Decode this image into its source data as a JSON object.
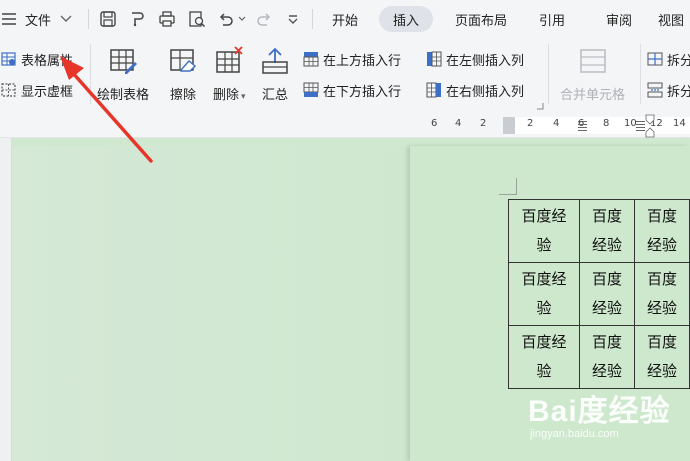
{
  "menubar": {
    "file_label": "文件",
    "tabs": [
      {
        "label": "开始",
        "active": false
      },
      {
        "label": "插入",
        "active": true
      },
      {
        "label": "页面布局",
        "active": false
      },
      {
        "label": "引用",
        "active": false
      },
      {
        "label": "审阅",
        "active": false
      },
      {
        "label": "视图",
        "active": false
      }
    ]
  },
  "ribbon": {
    "table_properties": "表格属性",
    "show_gridlines": "显示虚框",
    "draw_table": "绘制表格",
    "erase": "擦除",
    "delete": "删除",
    "summary": "汇总",
    "insert_row_above": "在上方插入行",
    "insert_row_below": "在下方插入行",
    "insert_col_left": "在左侧插入列",
    "insert_col_right": "在右侧插入列",
    "merge_cells": "合并单元格",
    "split_1": "拆分",
    "split_2": "拆分"
  },
  "ruler": {
    "ticks": [
      "6",
      "4",
      "2",
      "2",
      "4",
      "6",
      "8",
      "10",
      "12",
      "14"
    ]
  },
  "table": {
    "rows": [
      [
        "百度经验",
        "百度经验",
        "百度经验"
      ],
      [
        "百度经验",
        "百度经验",
        "百度经验"
      ],
      [
        "百度经验",
        "百度经验",
        "百度经验"
      ]
    ]
  },
  "watermark": {
    "logo": "Bai度经验",
    "site": "jingyan.baidu.com"
  },
  "colors": {
    "accent": "#e8352a",
    "doc_background": "#cfe8cf",
    "active_tab": "#dfe2e8"
  }
}
